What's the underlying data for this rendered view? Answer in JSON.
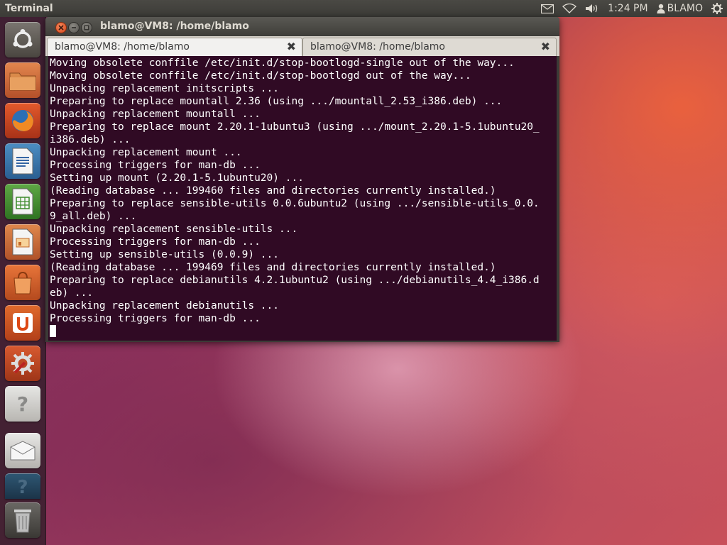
{
  "top_panel": {
    "app_name": "Terminal",
    "time": "1:24 PM",
    "user": "BLAMO",
    "indicators": [
      "mail-icon",
      "wifi-icon",
      "volume-icon",
      "user-icon",
      "gear-icon"
    ]
  },
  "launcher": {
    "items": [
      {
        "name": "dash-home",
        "icon": "ubuntu-logo-icon"
      },
      {
        "name": "files",
        "icon": "folder-icon"
      },
      {
        "name": "firefox",
        "icon": "firefox-icon"
      },
      {
        "name": "libreoffice-writer",
        "icon": "writer-icon"
      },
      {
        "name": "libreoffice-calc",
        "icon": "calc-icon"
      },
      {
        "name": "libreoffice-impress",
        "icon": "impress-icon"
      },
      {
        "name": "software-center",
        "icon": "shopping-bag-icon"
      },
      {
        "name": "ubuntu-one",
        "icon": "ubuntu-one-icon"
      },
      {
        "name": "system-settings",
        "icon": "settings-icon"
      },
      {
        "name": "unknown-app-1",
        "icon": "question-icon"
      },
      {
        "name": "mail-app",
        "icon": "envelope-icon"
      },
      {
        "name": "unknown-app-2",
        "icon": "question-icon"
      },
      {
        "name": "trash",
        "icon": "trash-icon"
      }
    ]
  },
  "window": {
    "title": "blamo@VM8: /home/blamo",
    "tabs": [
      {
        "label": "blamo@VM8: /home/blamo",
        "active": true
      },
      {
        "label": "blamo@VM8: /home/blamo",
        "active": false
      }
    ],
    "terminal_lines": [
      "Moving obsolete conffile /etc/init.d/stop-bootlogd-single out of the way...",
      "Moving obsolete conffile /etc/init.d/stop-bootlogd out of the way...",
      "Unpacking replacement initscripts ...",
      "Preparing to replace mountall 2.36 (using .../mountall_2.53_i386.deb) ...",
      "Unpacking replacement mountall ...",
      "Preparing to replace mount 2.20.1-1ubuntu3 (using .../mount_2.20.1-5.1ubuntu20_",
      "i386.deb) ...",
      "Unpacking replacement mount ...",
      "Processing triggers for man-db ...",
      "Setting up mount (2.20.1-5.1ubuntu20) ...",
      "(Reading database ... 199460 files and directories currently installed.)",
      "Preparing to replace sensible-utils 0.0.6ubuntu2 (using .../sensible-utils_0.0.",
      "9_all.deb) ...",
      "Unpacking replacement sensible-utils ...",
      "Processing triggers for man-db ...",
      "Setting up sensible-utils (0.0.9) ...",
      "(Reading database ... 199469 files and directories currently installed.)",
      "Preparing to replace debianutils 4.2.1ubuntu2 (using .../debianutils_4.4_i386.d",
      "eb) ...",
      "Unpacking replacement debianutils ...",
      "Processing triggers for man-db ..."
    ]
  },
  "colors": {
    "terminal_bg": "#300a24",
    "terminal_fg": "#ffffff",
    "panel_bg": "#3c3b37",
    "close_button": "#e05a2b"
  }
}
